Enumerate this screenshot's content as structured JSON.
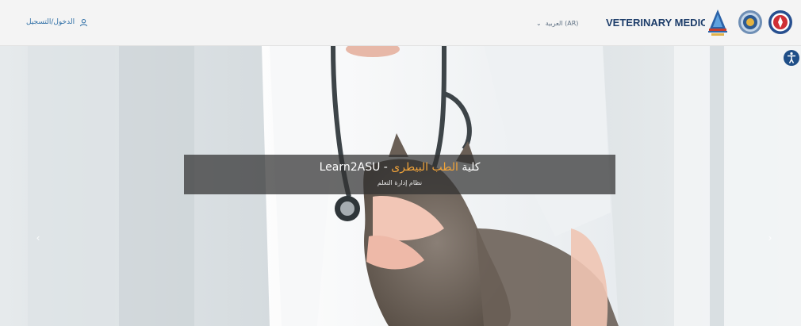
{
  "header": {
    "login_label": "الدخول/التسجيل",
    "language_label": "العربية (AR)",
    "brand_title": "VETERINARY MEDICINE"
  },
  "hero": {
    "title_prefix": "كلية ",
    "title_highlight": "الطب البيطرى",
    "title_suffix": " - Learn2ASU",
    "subtitle": "نظام إدارة التعلم"
  },
  "icons": {
    "user": "user-icon",
    "chevron": "chevron-down-icon",
    "prev": "chevron-left-icon",
    "next": "chevron-right-icon",
    "accessibility": "accessibility-icon"
  },
  "colors": {
    "brand": "#1d3d6a",
    "link": "#2f6fa6",
    "accent": "#f0a33a",
    "caption_bg": "#303030"
  }
}
